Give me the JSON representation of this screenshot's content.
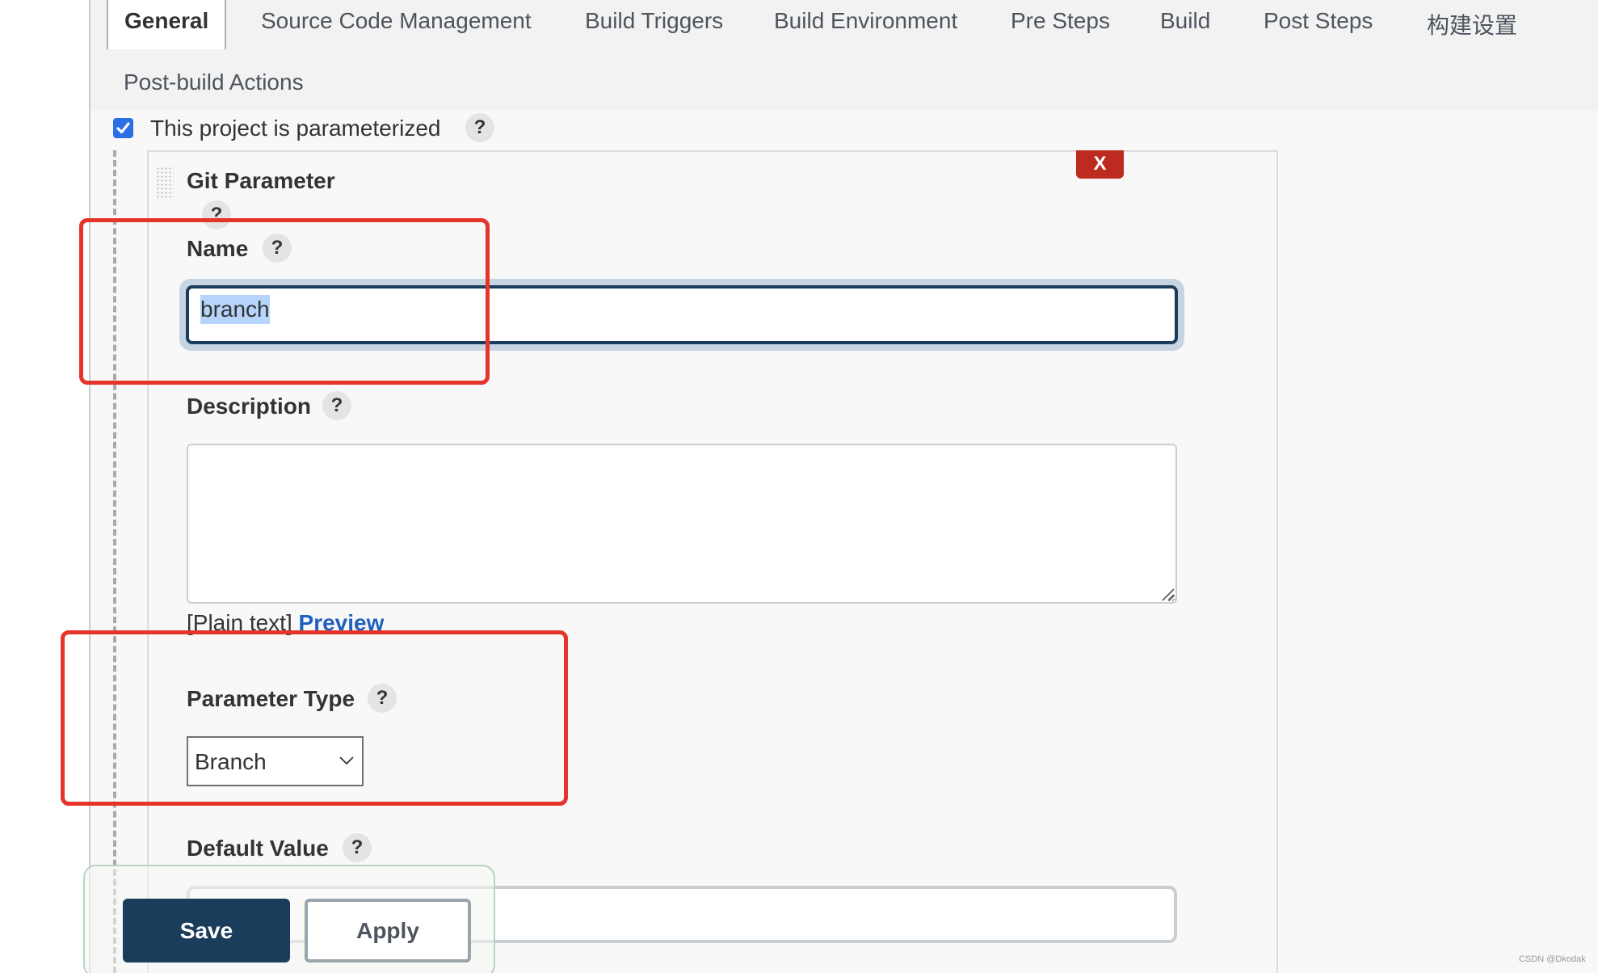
{
  "tabs": [
    {
      "label": "General",
      "active": true
    },
    {
      "label": "Source Code Management",
      "active": false
    },
    {
      "label": "Build Triggers",
      "active": false
    },
    {
      "label": "Build Environment",
      "active": false
    },
    {
      "label": "Pre Steps",
      "active": false
    },
    {
      "label": "Build",
      "active": false
    },
    {
      "label": "Post Steps",
      "active": false
    },
    {
      "label": "构建设置",
      "active": false
    },
    {
      "label": "Post-build Actions",
      "active": false
    }
  ],
  "parameterized": {
    "label": "This project is parameterized",
    "checked": true,
    "help": "?"
  },
  "git_parameter": {
    "title": "Git Parameter",
    "delete_label": "X",
    "help": "?",
    "name": {
      "label": "Name",
      "help": "?",
      "value": "branch"
    },
    "description": {
      "label": "Description",
      "help": "?",
      "value": "",
      "format_note": "[Plain text]",
      "preview_link": "Preview"
    },
    "parameter_type": {
      "label": "Parameter Type",
      "help": "?",
      "selected": "Branch"
    },
    "default_value": {
      "label": "Default Value",
      "help": "?",
      "value": ""
    }
  },
  "footer": {
    "save_label": "Save",
    "apply_label": "Apply"
  },
  "annotations": {
    "highlight_color": "#e5352b"
  },
  "watermark": "CSDN @Dkodak"
}
